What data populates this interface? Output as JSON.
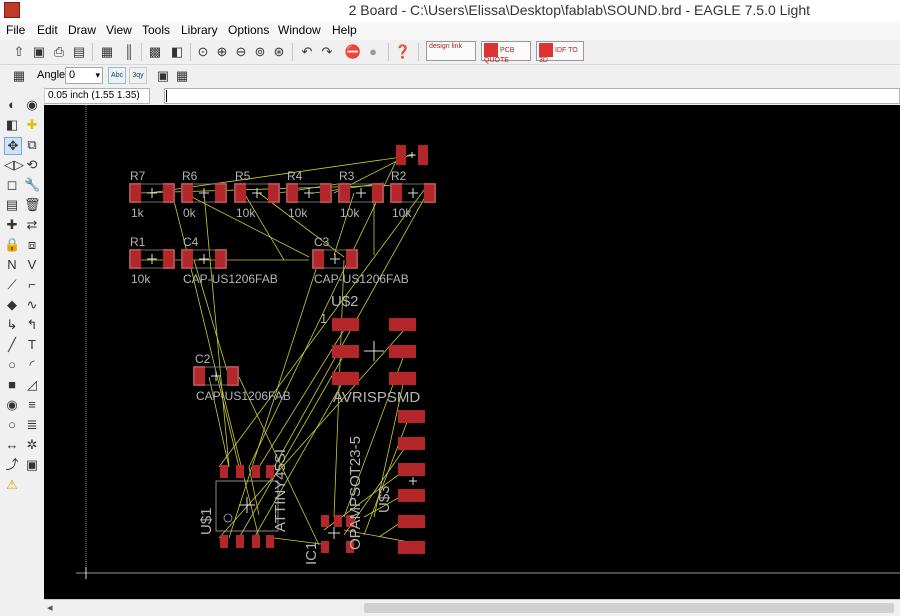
{
  "window": {
    "title": "2 Board - C:\\Users\\Elissa\\Desktop\\fablab\\SOUND.brd - EAGLE 7.5.0 Light"
  },
  "menu": [
    "File",
    "Edit",
    "Draw",
    "View",
    "Tools",
    "Library",
    "Options",
    "Window",
    "Help"
  ],
  "toolbar": {
    "buttons": [
      "open-icon",
      "save-icon",
      "print-icon",
      "cam-icon",
      "layers-icon",
      "script-icon",
      "board-icon",
      "schematic-icon",
      "zoom-fit-icon",
      "zoom-in-icon",
      "zoom-out-icon",
      "zoom-redraw-icon",
      "zoom-select-icon",
      "zoom-area-icon",
      "undo-icon",
      "redo-icon",
      "stop-icon",
      "go-icon",
      "help-icon"
    ],
    "design_link": "design link",
    "pcb_quote": "PCB QUOTE",
    "idf": "IDF TO 3D"
  },
  "params": {
    "grid_icon": "grid-icon",
    "angle_label": "Angle:",
    "angle_value": "0",
    "abc_label": "Abc",
    "abc2_label": "3qy"
  },
  "command": {
    "coordinates": "0.05 inch (1.55 1.35)",
    "value": ""
  },
  "palette_icons": [
    "info-icon",
    "show-icon",
    "display-icon",
    "mark-icon",
    "move-icon",
    "copy-icon",
    "mirror-icon",
    "rotate-icon",
    "group-icon",
    "change-icon",
    "paste-icon",
    "delete-icon",
    "add-icon",
    "replace-icon",
    "lock-icon",
    "smash-icon",
    "name-icon",
    "value-icon",
    "split-icon",
    "miter-icon",
    "optimize-icon",
    "meander-icon",
    "route-icon",
    "ripup-icon",
    "wire-icon",
    "text-icon",
    "circle-icon",
    "arc-icon",
    "rect-icon",
    "polygon-icon",
    "via-icon",
    "signal-icon",
    "hole-icon",
    "attribute-icon",
    "dimension-icon",
    "ratsnest-icon",
    "autorouter-icon",
    "drc-icon",
    "errors-icon"
  ],
  "board": {
    "colors": {
      "pad": "#b3262a",
      "wire": "#cccc33",
      "text": "#b5b5b5",
      "bg": "#000000"
    },
    "parts": [
      {
        "name": "R7",
        "value": "1k"
      },
      {
        "name": "R6",
        "value": "0k"
      },
      {
        "name": "R5",
        "value": "10k"
      },
      {
        "name": "R4",
        "value": "10k"
      },
      {
        "name": "R3",
        "value": "10k"
      },
      {
        "name": "R2",
        "value": "10k"
      },
      {
        "name": "R1",
        "value": "10k"
      },
      {
        "name": "C4",
        "value": "CAP-US1206FAB"
      },
      {
        "name": "C3",
        "value": "CAP-US1206FAB"
      },
      {
        "name": "C2",
        "value": "CAP-US1206FAB"
      },
      {
        "name": "U$2",
        "value": "AVRISPSMD"
      },
      {
        "name": "U$1",
        "value": "ATTINY45SI"
      },
      {
        "name": "IC1",
        "value": "OPAMPSOT23-5"
      },
      {
        "name": "U$3",
        "value": ""
      }
    ],
    "pin1_label": "1"
  }
}
